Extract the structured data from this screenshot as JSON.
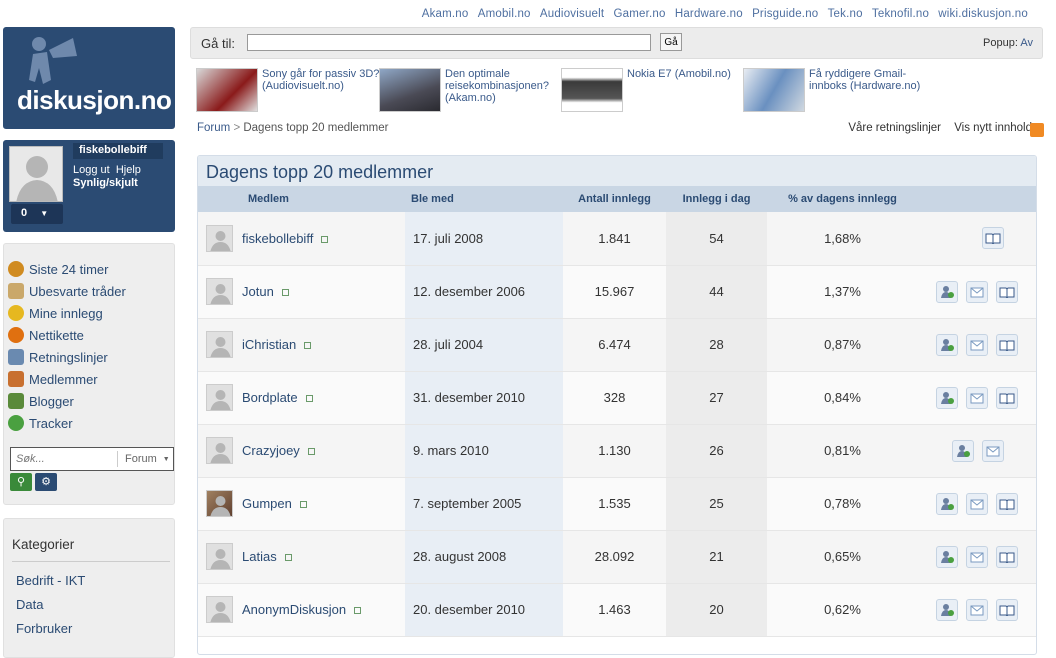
{
  "topnav": [
    "Akam.no",
    "Amobil.no",
    "Audiovisuelt",
    "Gamer.no",
    "Hardware.no",
    "Prisguide.no",
    "Tek.no",
    "Teknofil.no",
    "wiki.diskusjon.no"
  ],
  "logo": {
    "text": "diskusjon.no"
  },
  "user": {
    "name": "fiskebollebiff",
    "logout": "Logg ut",
    "help": "Hjelp",
    "visibility": "Synlig/skjult",
    "count": "0"
  },
  "menu": [
    {
      "label": "Siste 24 timer",
      "icon": "clock-icon",
      "color": "#d08b20"
    },
    {
      "label": "Ubesvarte tråder",
      "icon": "envelope-icon",
      "color": "#caa86a"
    },
    {
      "label": "Mine innlegg",
      "icon": "smiley-icon",
      "color": "#e6b820"
    },
    {
      "label": "Nettikette",
      "icon": "warning-icon",
      "color": "#e07010"
    },
    {
      "label": "Retningslinjer",
      "icon": "document-icon",
      "color": "#6a8ab0"
    },
    {
      "label": "Medlemmer",
      "icon": "members-icon",
      "color": "#c87030"
    },
    {
      "label": "Blogger",
      "icon": "blog-icon",
      "color": "#5a8a3a"
    },
    {
      "label": "Tracker",
      "icon": "bug-icon",
      "color": "#4aa040"
    }
  ],
  "search": {
    "placeholder": "Søk...",
    "scope": "Forum"
  },
  "categories": {
    "heading": "Kategorier",
    "items": [
      "Bedrift - IKT",
      "Data",
      "Forbruker"
    ]
  },
  "goto": {
    "label": "Gå til:",
    "button": "Gå",
    "popup_label": "Popup:",
    "popup_value": "Av"
  },
  "featured": [
    {
      "text": "Sony går for passiv 3D? (Audiovisuelt.no)"
    },
    {
      "text": "Den optimale reisekombinasjonen? (Akam.no)"
    },
    {
      "text": "Nokia E7 (Amobil.no)"
    },
    {
      "text": "Få ryddigere Gmail-innboks (Hardware.no)"
    }
  ],
  "breadcrumb": {
    "root": "Forum",
    "sep": ">",
    "current": "Dagens topp 20 medlemmer"
  },
  "header_links": {
    "guidelines": "Våre retningslinjer",
    "new_content": "Vis nytt innhold"
  },
  "board": {
    "title": "Dagens topp 20 medlemmer",
    "columns": [
      "Medlem",
      "Ble med",
      "Antall innlegg",
      "Innlegg i dag",
      "% av dagens innlegg"
    ],
    "rows": [
      {
        "member": "fiskebollebiff",
        "joined": "17. juli 2008",
        "posts": "1.841",
        "today": "54",
        "pct": "1,68%",
        "actions": [
          "read"
        ]
      },
      {
        "member": "Jotun",
        "joined": "12. desember 2006",
        "posts": "15.967",
        "today": "44",
        "pct": "1,37%",
        "actions": [
          "add",
          "pm",
          "read"
        ]
      },
      {
        "member": "iChristian",
        "joined": "28. juli 2004",
        "posts": "6.474",
        "today": "28",
        "pct": "0,87%",
        "actions": [
          "add",
          "pm",
          "read"
        ]
      },
      {
        "member": "Bordplate",
        "joined": "31. desember 2010",
        "posts": "328",
        "today": "27",
        "pct": "0,84%",
        "actions": [
          "add",
          "pm",
          "read"
        ]
      },
      {
        "member": "Crazyjoey",
        "joined": "9. mars 2010",
        "posts": "1.130",
        "today": "26",
        "pct": "0,81%",
        "actions": [
          "add",
          "pm"
        ]
      },
      {
        "member": "Gumpen",
        "joined": "7. september 2005",
        "posts": "1.535",
        "today": "25",
        "pct": "0,78%",
        "actions": [
          "add",
          "pm",
          "read"
        ]
      },
      {
        "member": "Latias",
        "joined": "28. august 2008",
        "posts": "28.092",
        "today": "21",
        "pct": "0,65%",
        "actions": [
          "add",
          "pm",
          "read"
        ]
      },
      {
        "member": "AnonymDiskusjon",
        "joined": "20. desember 2010",
        "posts": "1.463",
        "today": "20",
        "pct": "0,62%",
        "actions": [
          "add",
          "pm",
          "read"
        ]
      }
    ]
  },
  "colors": {
    "brand": "#2b4b73",
    "header_row": "#c9d6e4",
    "title_bar": "#e4ebf2"
  }
}
